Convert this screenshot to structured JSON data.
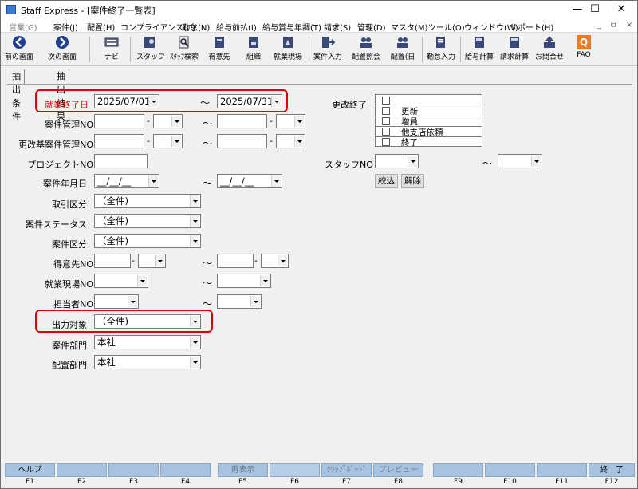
{
  "window": {
    "title": "Staff Express - [案件終了一覧表]",
    "minimize": "—",
    "maximize": "☐",
    "close": "✕",
    "mdi_min": "_",
    "mdi_restore": "⧉",
    "mdi_close": "×"
  },
  "menu": [
    "営業(G)",
    "案件(J)",
    "配置(H)",
    "コンプライアンス(C)",
    "勤怠(N)",
    "給与前払(I)",
    "給与賞与年調(T)",
    "請求(S)",
    "管理(D)",
    "マスタ(M)",
    "ツール(O)",
    "ウィンドウ(W)",
    "サポート(H)"
  ],
  "toolbar": {
    "prev": "前の画面",
    "next": "次の画面",
    "navi": "ナビ",
    "staff": "スタッフ",
    "staff_search": "ｽﾀｯﾌ検索",
    "customer": "得意先",
    "org": "組織",
    "site": "就業現場",
    "case_entry": "案件入力",
    "assign_inquiry": "配置照会",
    "assign": "配置(日",
    "attend": "勤怠入力",
    "pay_calc": "給与計算",
    "bill_calc": "請求計算",
    "contact": "お問合せ",
    "faq": "FAQ",
    "faq_icon": "Q"
  },
  "tabs": [
    "抽出条件",
    "抽出結果"
  ],
  "form": {
    "end_date": {
      "label": "就業終了日",
      "from": "2025/07/01",
      "to": "2025/07/31"
    },
    "case_no": {
      "label": "案件管理NO"
    },
    "renew_case_no": {
      "label": "更改基案件管理NO"
    },
    "project_no": {
      "label": "プロジェクトNO"
    },
    "case_date": {
      "label": "案件年月日",
      "from": "__/__/__",
      "to": "__/__/__"
    },
    "trade_type": {
      "label": "取引区分",
      "value": "（全件)"
    },
    "case_status": {
      "label": "案件ステータス",
      "value": "（全件)"
    },
    "case_type": {
      "label": "案件区分",
      "value": "（全件)"
    },
    "customer_no": {
      "label": "得意先NO"
    },
    "site_no": {
      "label": "就業現場NO"
    },
    "person_no": {
      "label": "担当者NO"
    },
    "output_target": {
      "label": "出力対象",
      "value": "（全件)"
    },
    "case_dept": {
      "label": "案件部門",
      "value": "本社"
    },
    "assign_dept": {
      "label": "配置部門",
      "value": "本社"
    },
    "renewal_end": {
      "label": "更改終了",
      "options": [
        "",
        "更新",
        "増員",
        "他支店依頼",
        "終了"
      ]
    },
    "staff_no": {
      "label": "スタッフNO"
    },
    "narrow_btn": "絞込",
    "clear_btn": "解除",
    "dash": "-",
    "tilde": "～"
  },
  "fkeys": [
    {
      "label": "ヘルプ",
      "key": "F1",
      "state": "on"
    },
    {
      "label": "",
      "key": "F2",
      "state": "on"
    },
    {
      "label": "",
      "key": "F3",
      "state": "on"
    },
    {
      "label": "",
      "key": "F4",
      "state": "on"
    },
    {
      "label": "再表示",
      "key": "F5",
      "state": "dis"
    },
    {
      "label": "",
      "key": "F6",
      "state": "act"
    },
    {
      "label": "ｸﾘｯﾌﾟﾎﾞｰﾄﾞ",
      "key": "F7",
      "state": "dis"
    },
    {
      "label": "プレビュー",
      "key": "F8",
      "state": "dis"
    },
    {
      "label": "",
      "key": "F9",
      "state": "on"
    },
    {
      "label": "",
      "key": "F10",
      "state": "on"
    },
    {
      "label": "",
      "key": "F11",
      "state": "on"
    },
    {
      "label": "終　了",
      "key": "F12",
      "state": "on"
    }
  ],
  "colors": {
    "highlight_red": "#e00000",
    "fkey_blue": "#a6c3e0"
  }
}
